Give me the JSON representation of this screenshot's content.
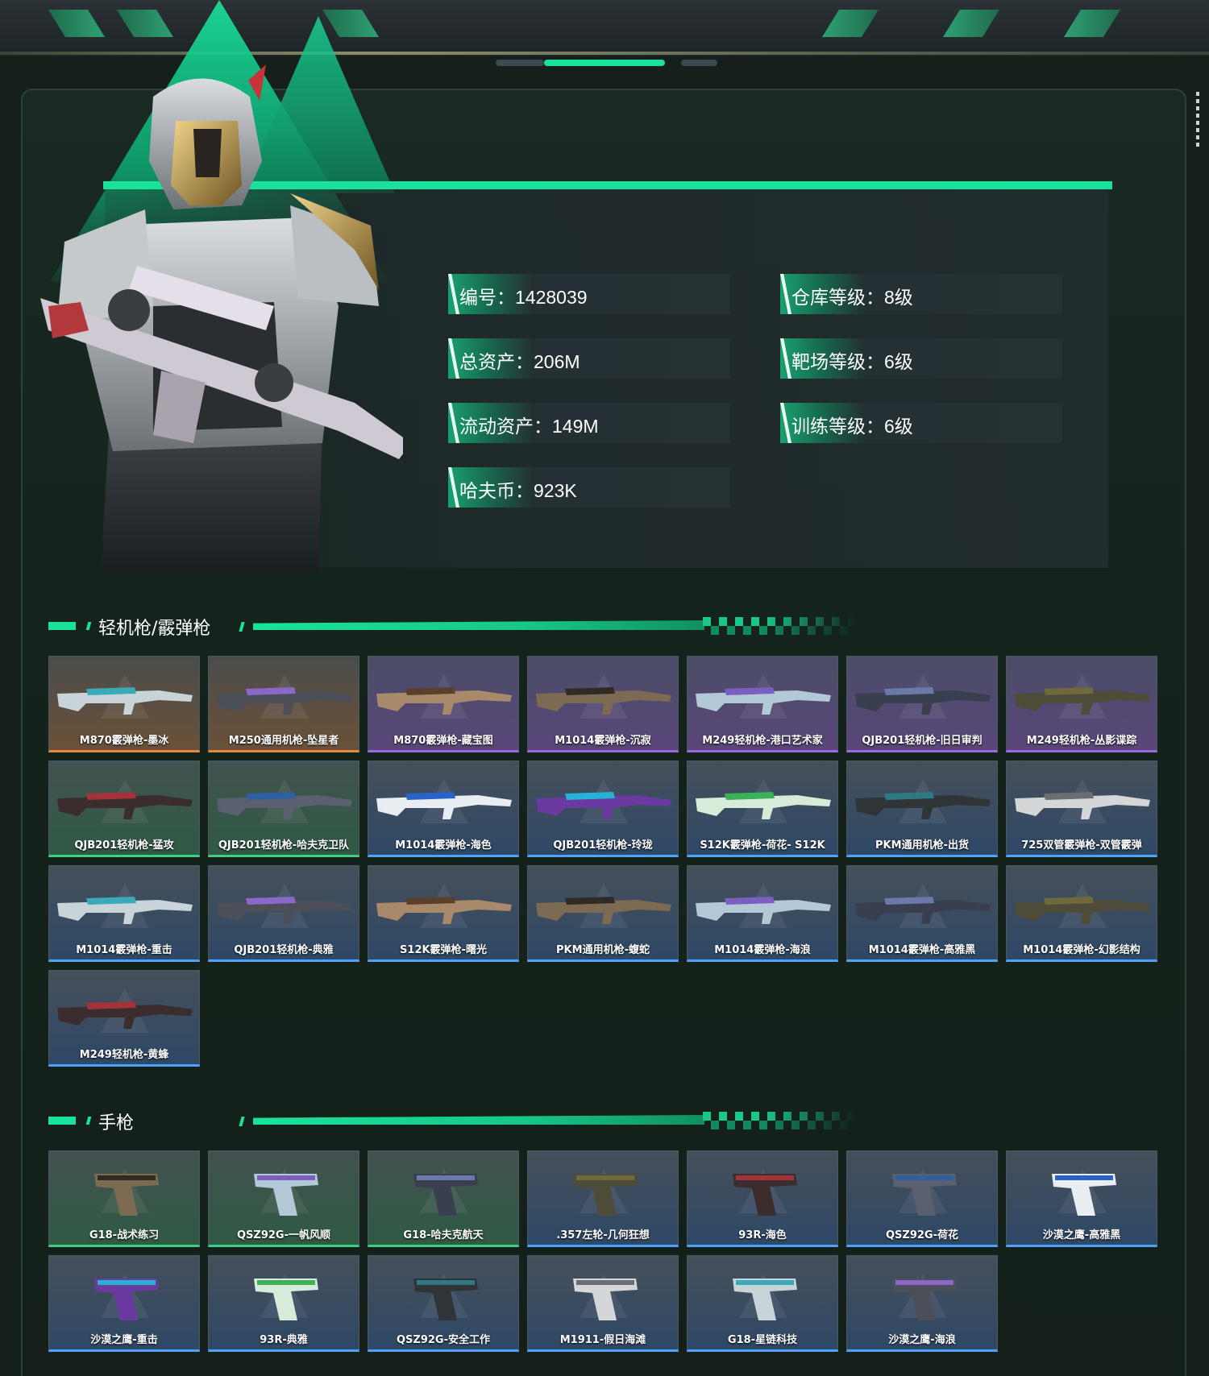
{
  "profile": {
    "stats": [
      {
        "label": "编号：",
        "value": "1428039"
      },
      {
        "label": "仓库等级：",
        "value": "8级"
      },
      {
        "label": "总资产：",
        "value": "206M"
      },
      {
        "label": "靶场等级：",
        "value": "6级"
      },
      {
        "label": "流动资产：",
        "value": "149M"
      },
      {
        "label": "训练等级：",
        "value": "6级"
      },
      {
        "label": "哈夫币：",
        "value": "923K"
      }
    ]
  },
  "sections": [
    {
      "title": "轻机枪/霰弹枪",
      "items": [
        {
          "name": "M870霰弹枪-墨冰",
          "rarity": "orange"
        },
        {
          "name": "M250通用机枪-坠星者",
          "rarity": "orange"
        },
        {
          "name": "M870霰弹枪-藏宝图",
          "rarity": "purple"
        },
        {
          "name": "M1014霰弹枪-沉寂",
          "rarity": "purple"
        },
        {
          "name": "M249轻机枪-港口艺术家",
          "rarity": "purple"
        },
        {
          "name": "QJB201轻机枪-旧日审判",
          "rarity": "purple"
        },
        {
          "name": "M249轻机枪-丛影谍踪",
          "rarity": "purple"
        },
        {
          "name": "QJB201轻机枪-猛攻",
          "rarity": "green"
        },
        {
          "name": "QJB201轻机枪-哈夫克卫队",
          "rarity": "green"
        },
        {
          "name": "M1014霰弹枪-海色",
          "rarity": "blue"
        },
        {
          "name": "QJB201轻机枪-玲珑",
          "rarity": "blue"
        },
        {
          "name": "S12K霰弹枪-荷花- S12K",
          "rarity": "blue"
        },
        {
          "name": "PKM通用机枪-出货",
          "rarity": "blue"
        },
        {
          "name": "725双管霰弹枪-双管霰弹",
          "rarity": "blue"
        },
        {
          "name": "M1014霰弹枪-重击",
          "rarity": "blue"
        },
        {
          "name": "QJB201轻机枪-典雅",
          "rarity": "blue"
        },
        {
          "name": "S12K霰弹枪-曙光",
          "rarity": "blue"
        },
        {
          "name": "PKM通用机枪-蝮蛇",
          "rarity": "blue"
        },
        {
          "name": "M1014霰弹枪-海浪",
          "rarity": "blue"
        },
        {
          "name": "M1014霰弹枪-高雅黑",
          "rarity": "blue"
        },
        {
          "name": "M1014霰弹枪-幻影结构",
          "rarity": "blue"
        },
        {
          "name": "M249轻机枪-黄蜂",
          "rarity": "blue"
        }
      ]
    },
    {
      "title": "手枪",
      "items": [
        {
          "name": "G18-战术练习",
          "rarity": "green"
        },
        {
          "name": "QSZ92G-一帆风顺",
          "rarity": "green"
        },
        {
          "name": "G18-哈夫克航天",
          "rarity": "green"
        },
        {
          "name": ".357左轮-几何狂想",
          "rarity": "blue"
        },
        {
          "name": "93R-海色",
          "rarity": "blue"
        },
        {
          "name": "QSZ92G-荷花",
          "rarity": "blue"
        },
        {
          "name": "沙漠之鹰-高雅黑",
          "rarity": "blue"
        },
        {
          "name": "沙漠之鹰-重击",
          "rarity": "blue"
        },
        {
          "name": "93R-典雅",
          "rarity": "blue"
        },
        {
          "name": "QSZ92G-安全工作",
          "rarity": "blue"
        },
        {
          "name": "M1911-假日海滩",
          "rarity": "blue"
        },
        {
          "name": "G18-星链科技",
          "rarity": "blue"
        },
        {
          "name": "沙漠之鹰-海浪",
          "rarity": "blue"
        }
      ]
    }
  ],
  "colors": {
    "accent": "#19e39a",
    "orange": "#e58b3a",
    "purple": "#9b6ae0",
    "green": "#3fcf86",
    "blue": "#4fa3ff"
  },
  "icons": {
    "card_watermark": "delta-triangle-watermark-icon",
    "side_menu": "vertical-dots-icon"
  }
}
